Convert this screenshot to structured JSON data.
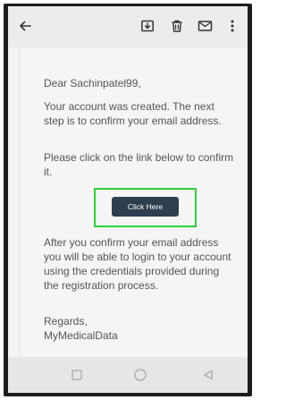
{
  "toolbar": {
    "back_icon": "arrow-left-icon",
    "icons": [
      "download-icon",
      "delete-icon",
      "mail-icon",
      "more-vert-icon"
    ]
  },
  "email": {
    "greeting": "Dear Sachinpatel99,",
    "paragraph1": "Your account was created. The next step is to confirm your email address.",
    "paragraph2": "Please click on the link below to confirm it.",
    "button_label": "Click Here",
    "paragraph3": "After you confirm your email address you will be able to login to your account using the credentials provided during the registration process.",
    "regards": "Regards,",
    "signature": "MyMedicalData"
  },
  "navbar": {
    "icons": [
      "recents-square-icon",
      "home-circle-icon",
      "back-triangle-icon"
    ]
  },
  "colors": {
    "button_bg": "#2c3e50",
    "highlight_border": "#2bd13a",
    "body_text": "#555555"
  }
}
